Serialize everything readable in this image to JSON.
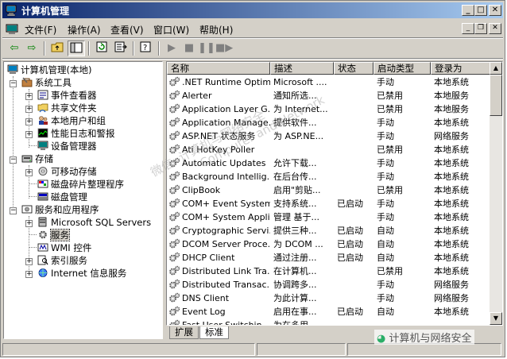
{
  "window": {
    "title": "计算机管理"
  },
  "menu": {
    "items": [
      "文件(F)",
      "操作(A)",
      "查看(V)",
      "窗口(W)",
      "帮助(H)"
    ]
  },
  "tree": {
    "root": "计算机管理(本地)",
    "groups": [
      {
        "label": "系统工具",
        "children": [
          "事件查看器",
          "共享文件夹",
          "本地用户和组",
          "性能日志和警报",
          "设备管理器"
        ]
      },
      {
        "label": "存储",
        "children": [
          "可移动存储",
          "磁盘碎片整理程序",
          "磁盘管理"
        ]
      },
      {
        "label": "服务和应用程序",
        "children": [
          "Microsoft SQL Servers",
          "服务",
          "WMI 控件",
          "索引服务",
          "Internet 信息服务"
        ]
      }
    ]
  },
  "list": {
    "columns": [
      "名称",
      "描述",
      "状态",
      "启动类型",
      "登录为"
    ],
    "rows": [
      [
        ".NET Runtime Optim...",
        "Microsoft ....",
        "",
        "手动",
        "本地系统"
      ],
      [
        "Alerter",
        "通知所选...",
        "",
        "已禁用",
        "本地服务"
      ],
      [
        "Application Layer G...",
        "为 Internet...",
        "",
        "已禁用",
        "本地服务"
      ],
      [
        "Application Manage...",
        "提供软件...",
        "",
        "手动",
        "本地系统"
      ],
      [
        "ASP.NET 状态服务",
        "为 ASP.NE...",
        "",
        "手动",
        "网络服务"
      ],
      [
        "Ati HotKey Poller",
        "",
        "",
        "已禁用",
        "本地系统"
      ],
      [
        "Automatic Updates",
        "允许下载...",
        "",
        "手动",
        "本地系统"
      ],
      [
        "Background Intellig...",
        "在后台传...",
        "",
        "手动",
        "本地系统"
      ],
      [
        "ClipBook",
        "启用\"剪贴...",
        "",
        "已禁用",
        "本地系统"
      ],
      [
        "COM+ Event System",
        "支持系统...",
        "已启动",
        "手动",
        "本地系统"
      ],
      [
        "COM+ System Appli...",
        "管理 基于...",
        "",
        "手动",
        "本地系统"
      ],
      [
        "Cryptographic Servi...",
        "提供三种...",
        "已启动",
        "自动",
        "本地系统"
      ],
      [
        "DCOM Server Proce...",
        "为 DCOM ...",
        "已启动",
        "自动",
        "本地系统"
      ],
      [
        "DHCP Client",
        "通过注册...",
        "已启动",
        "自动",
        "本地系统"
      ],
      [
        "Distributed Link Tra...",
        "在计算机...",
        "",
        "已禁用",
        "本地系统"
      ],
      [
        "Distributed Transac...",
        "协调跨多...",
        "",
        "手动",
        "网络服务"
      ],
      [
        "DNS Client",
        "为此计算...",
        "",
        "手动",
        "网络服务"
      ],
      [
        "Event Log",
        "启用在事...",
        "已启动",
        "自动",
        "本地系统"
      ],
      [
        "Fast User Switchin...",
        "为在多用...",
        "",
        "",
        ""
      ]
    ]
  },
  "tabs": [
    "扩展",
    "标准"
  ],
  "watermark": {
    "line1": "微信: 计算机与网络安全",
    "line2": "Computer and Network"
  },
  "wechat_badge": "计算机与网络安全"
}
